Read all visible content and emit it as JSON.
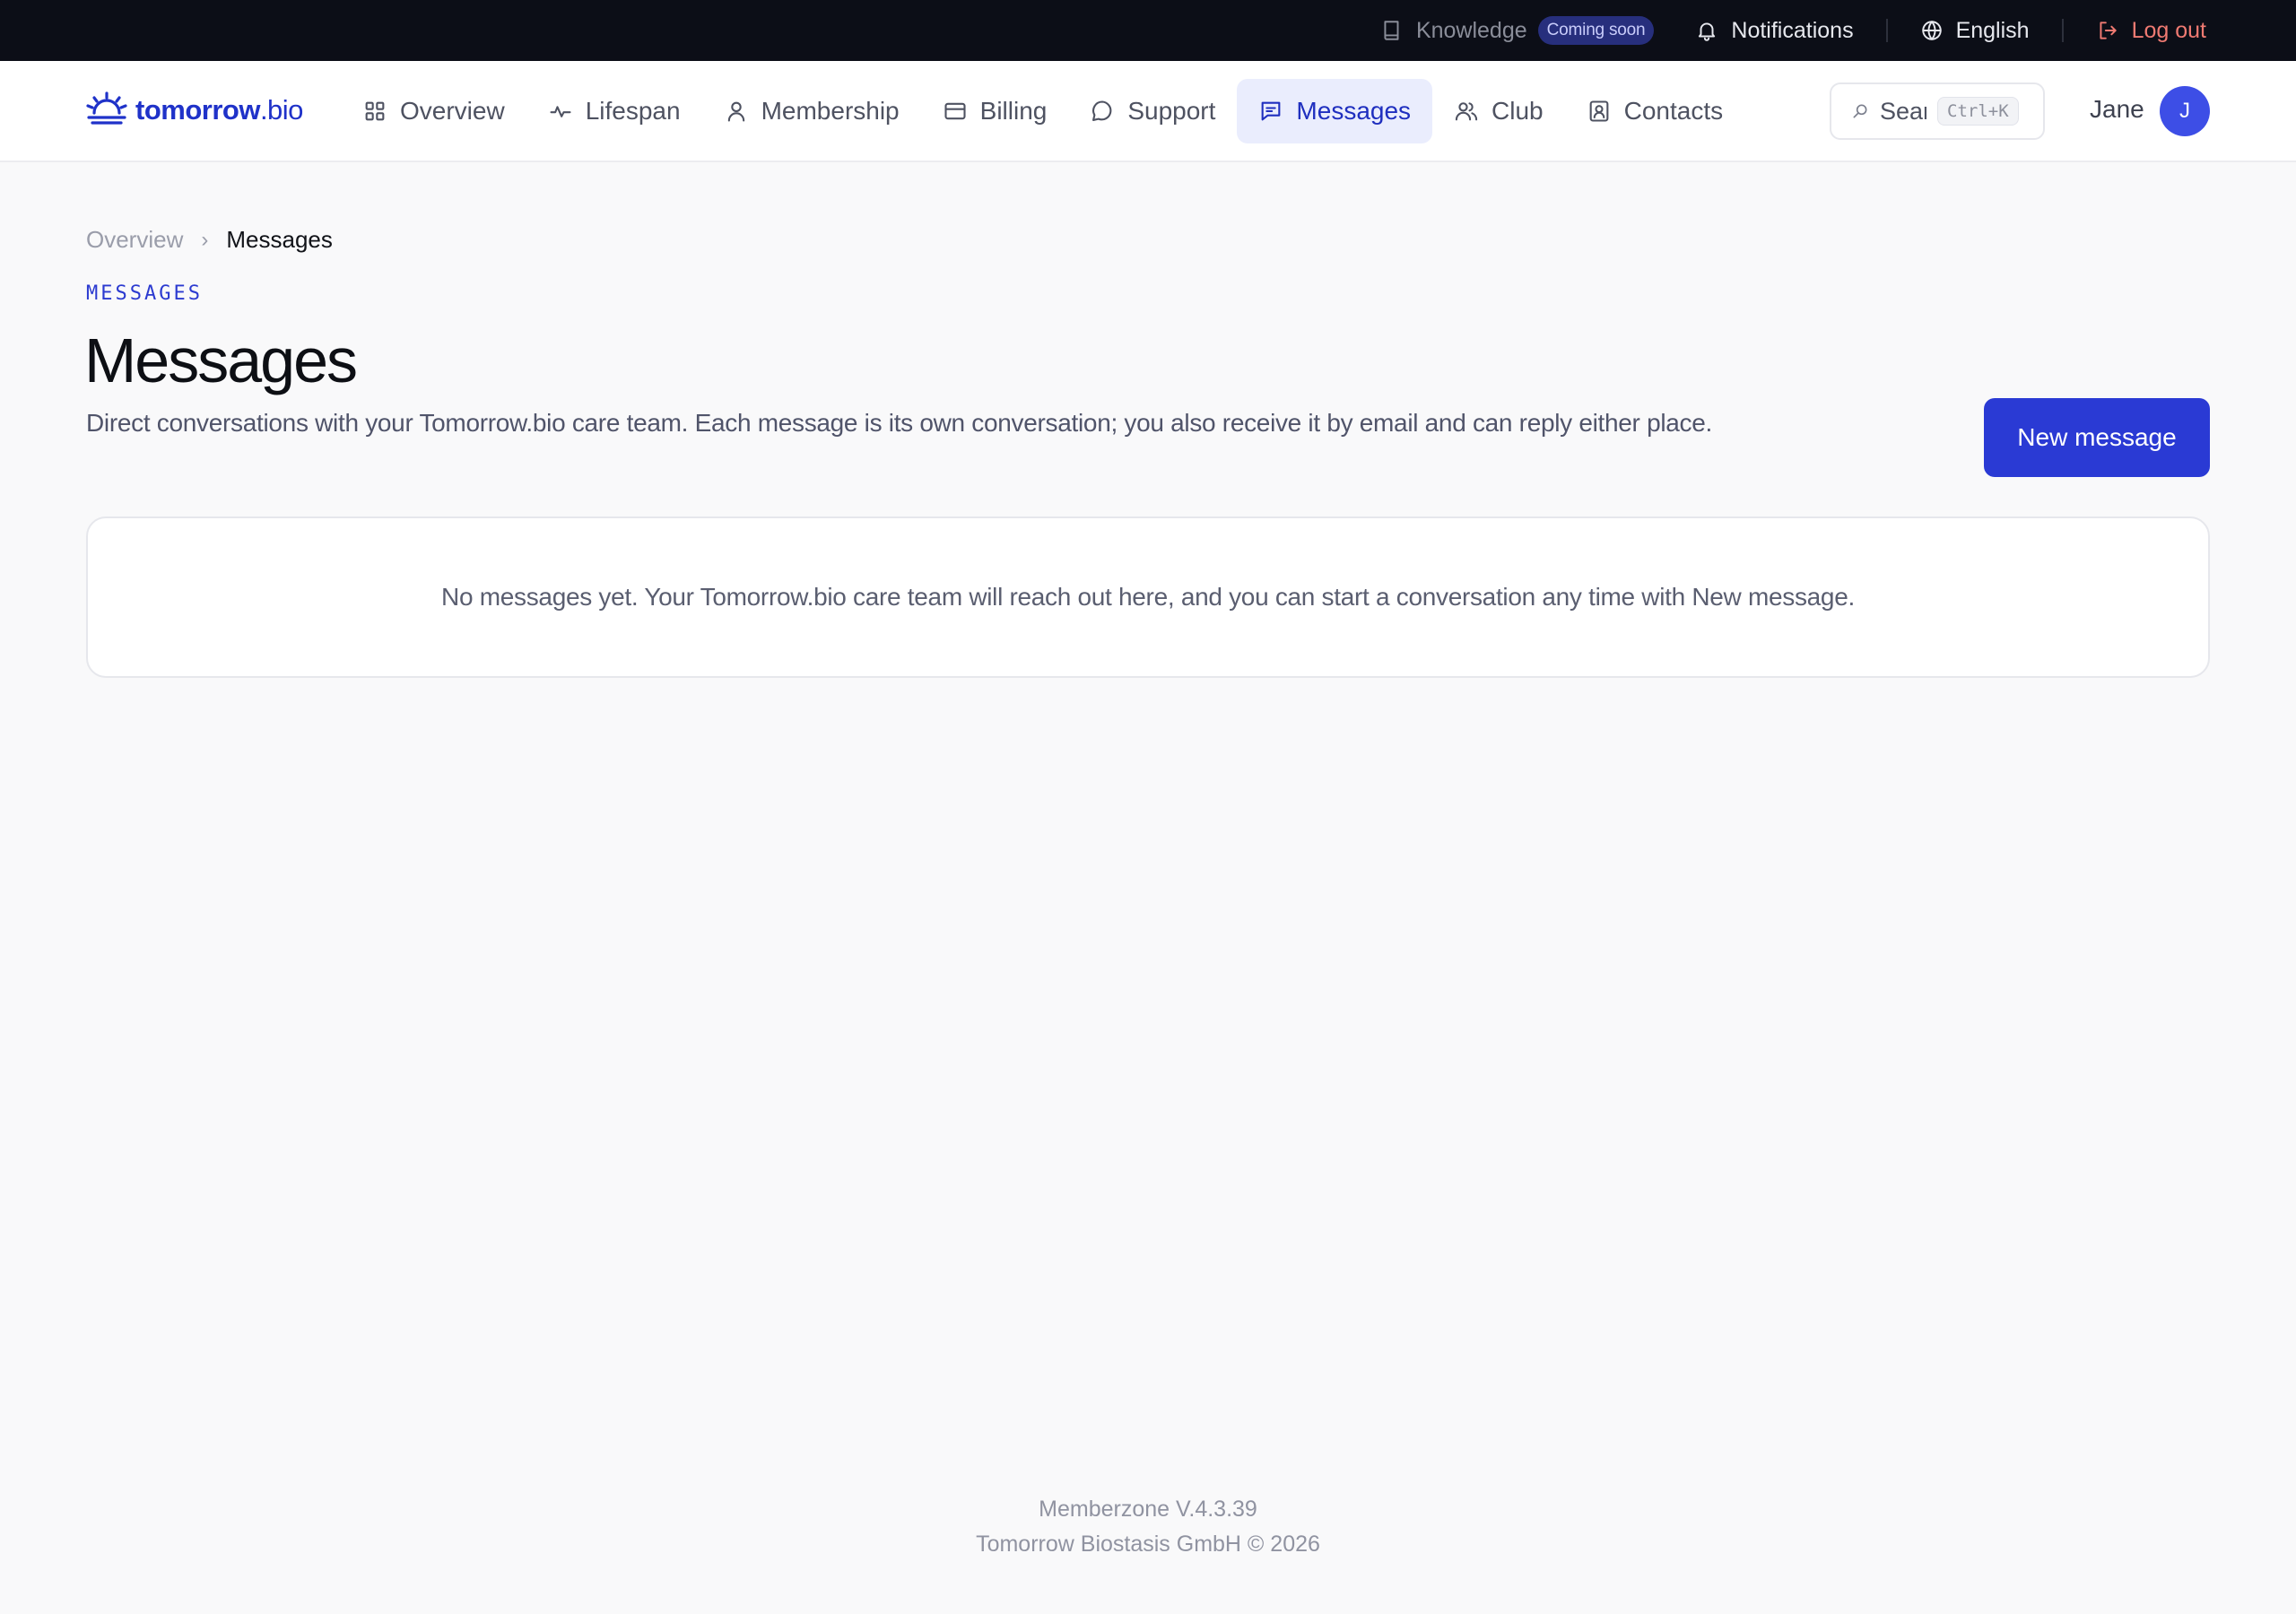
{
  "topbar": {
    "knowledge_label": "Knowledge",
    "knowledge_badge": "Coming soon",
    "notifications_label": "Notifications",
    "language_label": "English",
    "logout_label": "Log out"
  },
  "brand": {
    "name_main": "tomorrow",
    "name_suffix": ".bio",
    "color": "#1f32c9"
  },
  "nav": {
    "items": [
      {
        "label": "Overview",
        "icon": "grid-icon"
      },
      {
        "label": "Lifespan",
        "icon": "activity-icon"
      },
      {
        "label": "Membership",
        "icon": "user-icon"
      },
      {
        "label": "Billing",
        "icon": "credit-card-icon"
      },
      {
        "label": "Support",
        "icon": "chat-bubble-icon"
      },
      {
        "label": "Messages",
        "icon": "message-square-icon",
        "active": true
      },
      {
        "label": "Club",
        "icon": "users-icon"
      },
      {
        "label": "Contacts",
        "icon": "contact-card-icon"
      }
    ],
    "search_placeholder": "Sear",
    "search_shortcut": "Ctrl+K",
    "user_name": "Jane",
    "user_initial": "J"
  },
  "breadcrumb": {
    "parent": "Overview",
    "separator": "›",
    "current": "Messages"
  },
  "page": {
    "eyebrow": "MESSAGES",
    "title": "Messages",
    "description": "Direct conversations with your Tomorrow.bio care team. Each message is its own conversation; you also receive it by email and can reply either place.",
    "new_message_button": "New message",
    "empty_state": "No messages yet. Your Tomorrow.bio care team will reach out here, and you can start a conversation any time with New message."
  },
  "footer": {
    "version": "Memberzone V.4.3.39",
    "copyright": "Tomorrow Biostasis GmbH © 2026"
  },
  "colors": {
    "accent": "#2a3ad4",
    "active_nav_bg": "#eaedfd",
    "topbar_bg": "#0c0e17",
    "logout": "#f07a72",
    "page_bg": "#f9f9fa"
  }
}
